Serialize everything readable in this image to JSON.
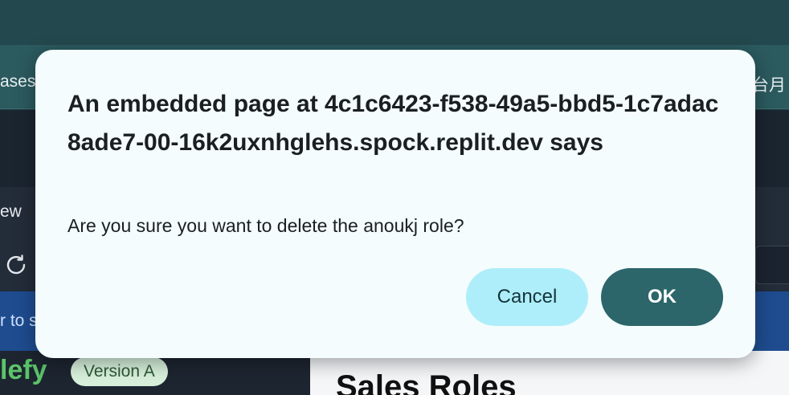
{
  "background": {
    "tab_left_fragment": "ases",
    "tab_right_fragment": "台月",
    "subbar_label_fragment": "ew",
    "banner_text_fragment": "r to s",
    "brand_fragment": "lefy",
    "version_badge": "Version A",
    "page_heading": "Sales Roles"
  },
  "dialog": {
    "title": "An embedded page at 4c1c6423-f538-49a5-bbd5-1c7adac8ade7-00-16k2uxnhglehs.spock.replit.dev says",
    "message": "Are you sure you want to delete the anoukj role?",
    "cancel_label": "Cancel",
    "ok_label": "OK"
  },
  "colors": {
    "dialog_bg": "#f4fcfd",
    "cancel_bg": "#aeeefa",
    "ok_bg": "#2c666b"
  }
}
